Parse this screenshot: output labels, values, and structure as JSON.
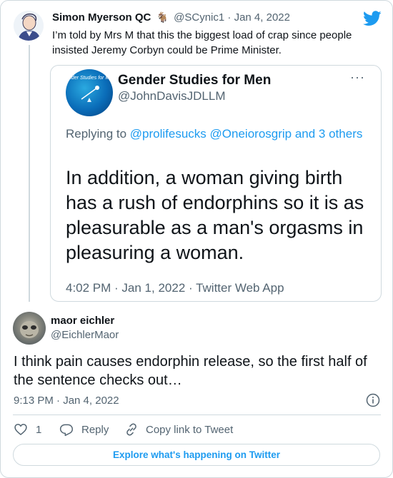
{
  "parent_tweet": {
    "author_name": "Simon Myerson QC",
    "author_emoji": "🐐",
    "handle": "@SCynic1",
    "separator": "·",
    "date": "Jan 4, 2022",
    "text": "I’m told by Mrs M that this the biggest load of crap since people insisted Jeremy Corbyn could be Prime Minister."
  },
  "quoted_tweet": {
    "avatar_text": "nder Studies for M",
    "author_name": "Gender Studies for Men",
    "handle": "@JohnDavisJDLLM",
    "more": "···",
    "replying_prefix": "Replying to",
    "replying_to": "@prolifesucks @Oneiorosgrip and 3 others",
    "text": "In addition, a woman giving birth has a rush of endorphins so it is as pleasurable as a man's orgasms in pleasuring a woman.",
    "footer": "4:02 PM · Jan 1, 2022 · Twitter Web App"
  },
  "reply_tweet": {
    "author_name": "maor eichler",
    "handle": "@EichlerMaor",
    "text": "I think pain causes endorphin release, so the first half of the sentence checks out…",
    "timestamp": "9:13 PM · Jan 4, 2022"
  },
  "actions": {
    "like_count": "1",
    "reply_label": "Reply",
    "copy_link_label": "Copy link to Tweet"
  },
  "explore_label": "Explore what's happening on Twitter",
  "icons": {
    "brand": "twitter-bird-icon",
    "info": "info-icon",
    "like": "heart-icon",
    "reply": "reply-icon",
    "copy": "link-icon"
  },
  "colors": {
    "accent": "#1d9bf0",
    "text": "#0f1419",
    "muted": "#536471",
    "border": "#cfd9de"
  }
}
